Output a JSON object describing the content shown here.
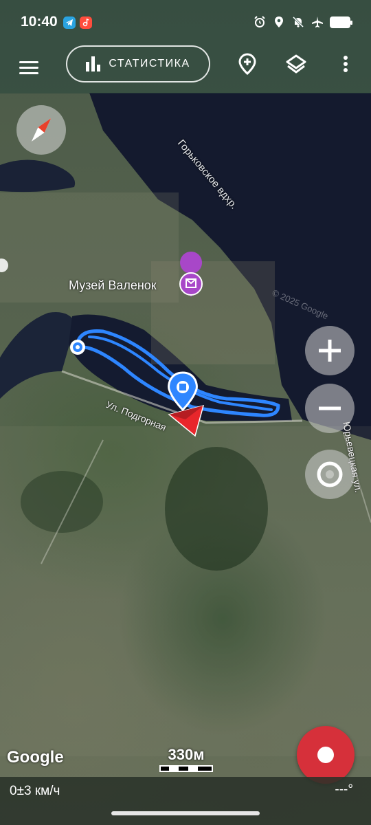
{
  "status_bar": {
    "time": "10:40",
    "left_icons": [
      "telegram-icon",
      "music-app-icon"
    ],
    "right_icons": [
      "alarm-icon",
      "location-icon",
      "mute-icon",
      "airplane-icon",
      "battery-icon"
    ]
  },
  "toolbar": {
    "stats_label": "СТАТИСТИКА",
    "icons": [
      "menu-icon",
      "bar-chart-icon",
      "add-location-icon",
      "layers-icon",
      "more-vert-icon"
    ]
  },
  "map": {
    "water_label": "Горьковское вдхр.",
    "poi_label": "Музей Валенок",
    "street_1": "Ул. Подгорная",
    "street_2": "Юрьевецкая ул.",
    "copyright": "© 2025 Google",
    "provider_logo": "Google",
    "scale": "330м"
  },
  "colors": {
    "track": "#2e86ff",
    "record": "#d6303a",
    "position_arrow": "#e8262b"
  },
  "bottom_bar": {
    "speed": "0±3 км/ч",
    "heading": "---°"
  }
}
